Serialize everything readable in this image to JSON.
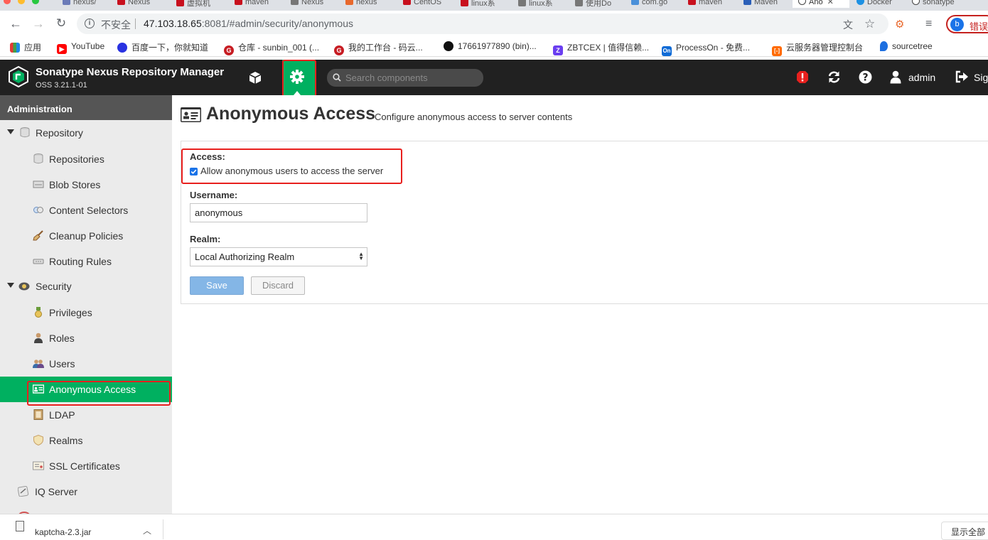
{
  "browser": {
    "tabs": [
      {
        "label": "nexus/"
      },
      {
        "label": "Nexus"
      },
      {
        "label": "虚拟机"
      },
      {
        "label": "maven"
      },
      {
        "label": "Nexus"
      },
      {
        "label": "nexus"
      },
      {
        "label": "CentOS"
      },
      {
        "label": "linux系"
      },
      {
        "label": "linux系"
      },
      {
        "label": "使用Do"
      },
      {
        "label": "com.go"
      },
      {
        "label": "maven"
      },
      {
        "label": "Maven"
      },
      {
        "label": "Ano",
        "active": true
      },
      {
        "label": "Docker"
      },
      {
        "label": "sonatype"
      }
    ],
    "security_label": "不安全",
    "url_host": "47.103.18.65",
    "url_rest": ":8081/#admin/security/anonymous",
    "profile_initial": "b",
    "profile_error": "错误",
    "bookmarks": [
      {
        "label": "应用",
        "icon": "apps-grid-icon"
      },
      {
        "label": "YouTube",
        "icon": "youtube-icon"
      },
      {
        "label": "百度一下，你就知道",
        "icon": "baidu-icon"
      },
      {
        "label": "仓库 - sunbin_001 (...",
        "icon": "gitee-icon"
      },
      {
        "label": "我的工作台 - 码云...",
        "icon": "gitee-icon"
      },
      {
        "label": "17661977890 (bin)...",
        "icon": "github-icon"
      },
      {
        "label": "ZBTCEX | 值得信赖...",
        "icon": "zbtcex-icon"
      },
      {
        "label": "ProcessOn - 免费...",
        "icon": "processon-icon"
      },
      {
        "label": "云服务器管理控制台",
        "icon": "aliyun-icon"
      },
      {
        "label": "sourcetree",
        "icon": "map-pin-icon"
      }
    ]
  },
  "header": {
    "title": "Sonatype Nexus Repository Manager",
    "version": "OSS 3.21.1-01",
    "search_placeholder": "Search components",
    "user": "admin",
    "signout": "Sig"
  },
  "sidebar": {
    "title": "Administration",
    "items": [
      {
        "label": "Repository",
        "level": 0,
        "icon": "database-icon"
      },
      {
        "label": "Repositories",
        "level": 1,
        "icon": "database-icon"
      },
      {
        "label": "Blob Stores",
        "level": 1,
        "icon": "hard-drive-icon"
      },
      {
        "label": "Content Selectors",
        "level": 1,
        "icon": "content-selector-icon"
      },
      {
        "label": "Cleanup Policies",
        "level": 1,
        "icon": "broom-icon"
      },
      {
        "label": "Routing Rules",
        "level": 1,
        "icon": "routing-icon"
      },
      {
        "label": "Security",
        "level": 0,
        "icon": "security-badge-icon"
      },
      {
        "label": "Privileges",
        "level": 1,
        "icon": "medal-icon"
      },
      {
        "label": "Roles",
        "level": 1,
        "icon": "role-icon"
      },
      {
        "label": "Users",
        "level": 1,
        "icon": "users-icon"
      },
      {
        "label": "Anonymous Access",
        "level": 1,
        "icon": "id-card-icon",
        "selected": true
      },
      {
        "label": "LDAP",
        "level": 1,
        "icon": "address-book-icon"
      },
      {
        "label": "Realms",
        "level": 1,
        "icon": "shield-icon"
      },
      {
        "label": "SSL Certificates",
        "level": 1,
        "icon": "certificate-icon"
      },
      {
        "label": "IQ Server",
        "level": 0,
        "icon": "iq-server-icon"
      }
    ]
  },
  "page": {
    "title": "Anonymous Access",
    "description": "Configure anonymous access to server contents",
    "access_label": "Access:",
    "allow_label": "Allow anonymous users to access the server",
    "allow_checked": true,
    "username_label": "Username:",
    "username_value": "anonymous",
    "realm_label": "Realm:",
    "realm_value": "Local Authorizing Realm",
    "save_label": "Save",
    "discard_label": "Discard"
  },
  "downloads": {
    "file_name": "kaptcha-2.3.jar",
    "show_all": "显示全部"
  },
  "colors": {
    "nexus_green": "#00b060",
    "header_bg": "#212121",
    "highlight_red": "#e8201e",
    "save_blue": "#84b6e6"
  }
}
